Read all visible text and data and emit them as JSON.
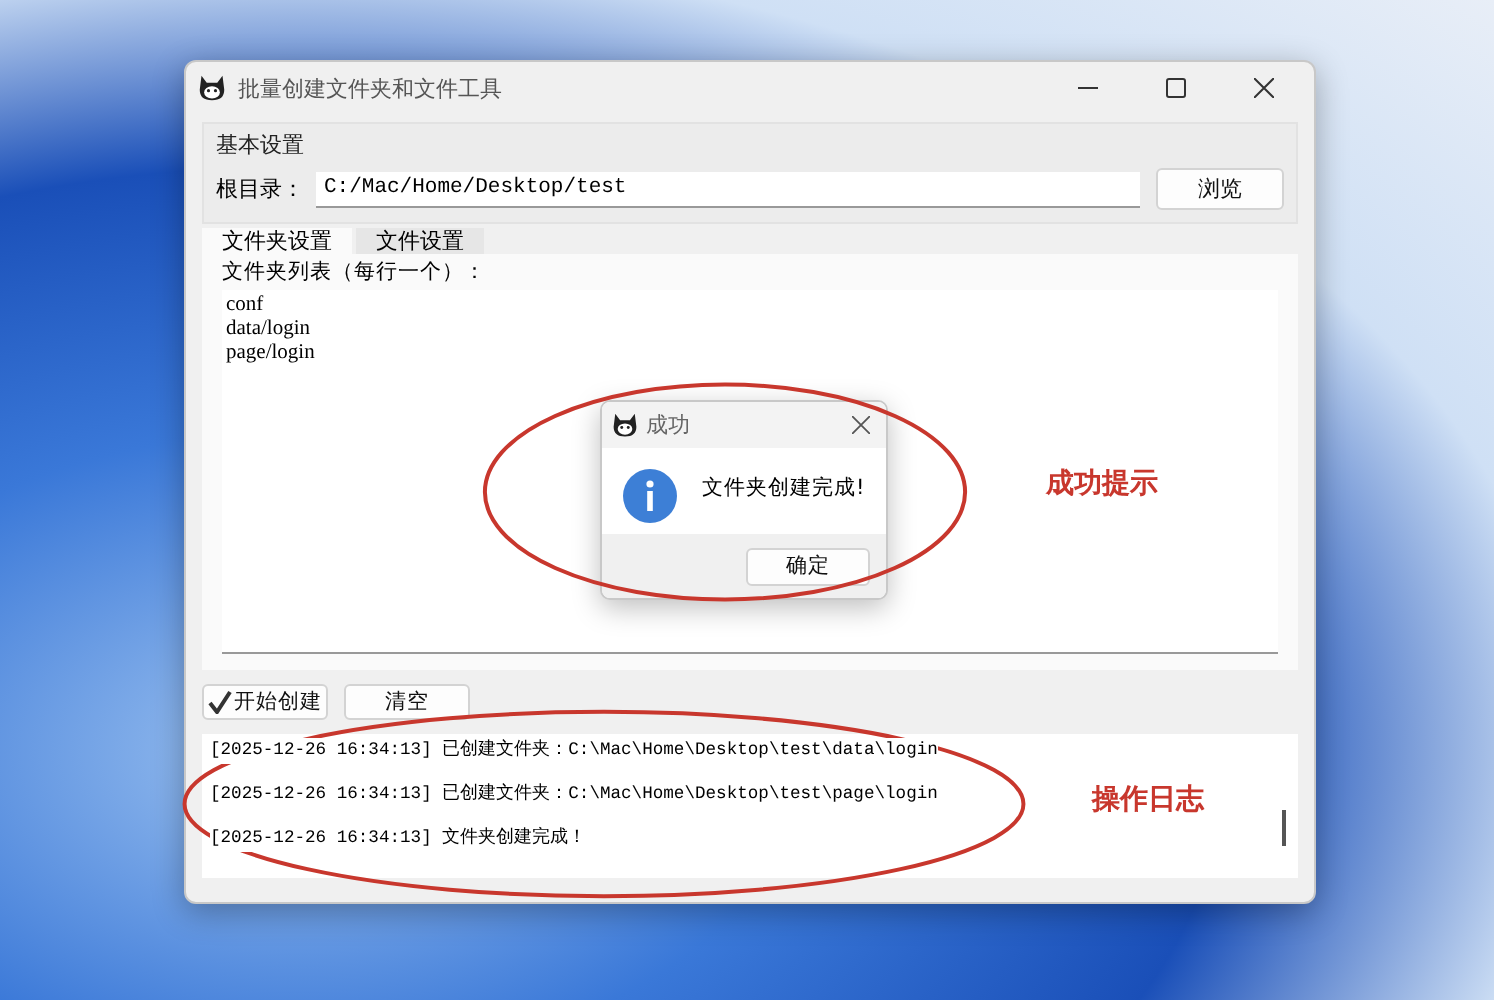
{
  "window": {
    "title": "批量创建文件夹和文件工具"
  },
  "basic_settings": {
    "title": "基本设置",
    "root_label": "根目录：",
    "root_value": "C:/Mac/Home/Desktop/test",
    "browse_button": "浏览"
  },
  "tabs": [
    {
      "label": "文件夹设置",
      "selected": true
    },
    {
      "label": "文件设置",
      "selected": false
    }
  ],
  "folder_list": {
    "label": "文件夹列表（每行一个）：",
    "lines": [
      "conf",
      "data/login",
      "page/login"
    ]
  },
  "actions": [
    {
      "label": "开始创建",
      "kind": "check"
    },
    {
      "label": "清空",
      "kind": "plain"
    }
  ],
  "log": {
    "lines": [
      "[2025-12-26 16:34:13] 已创建文件夹：C:\\Mac\\Home\\Desktop\\test\\data\\login",
      "[2025-12-26 16:34:13] 已创建文件夹：C:\\Mac\\Home\\Desktop\\test\\page\\login",
      "[2025-12-26 16:34:13] 文件夹创建完成！"
    ]
  },
  "dialog": {
    "title": "成功",
    "message": "文件夹创建完成!",
    "ok_button": "确定"
  },
  "annotations": [
    {
      "text": "成功提示"
    },
    {
      "text": "操作日志"
    }
  ]
}
